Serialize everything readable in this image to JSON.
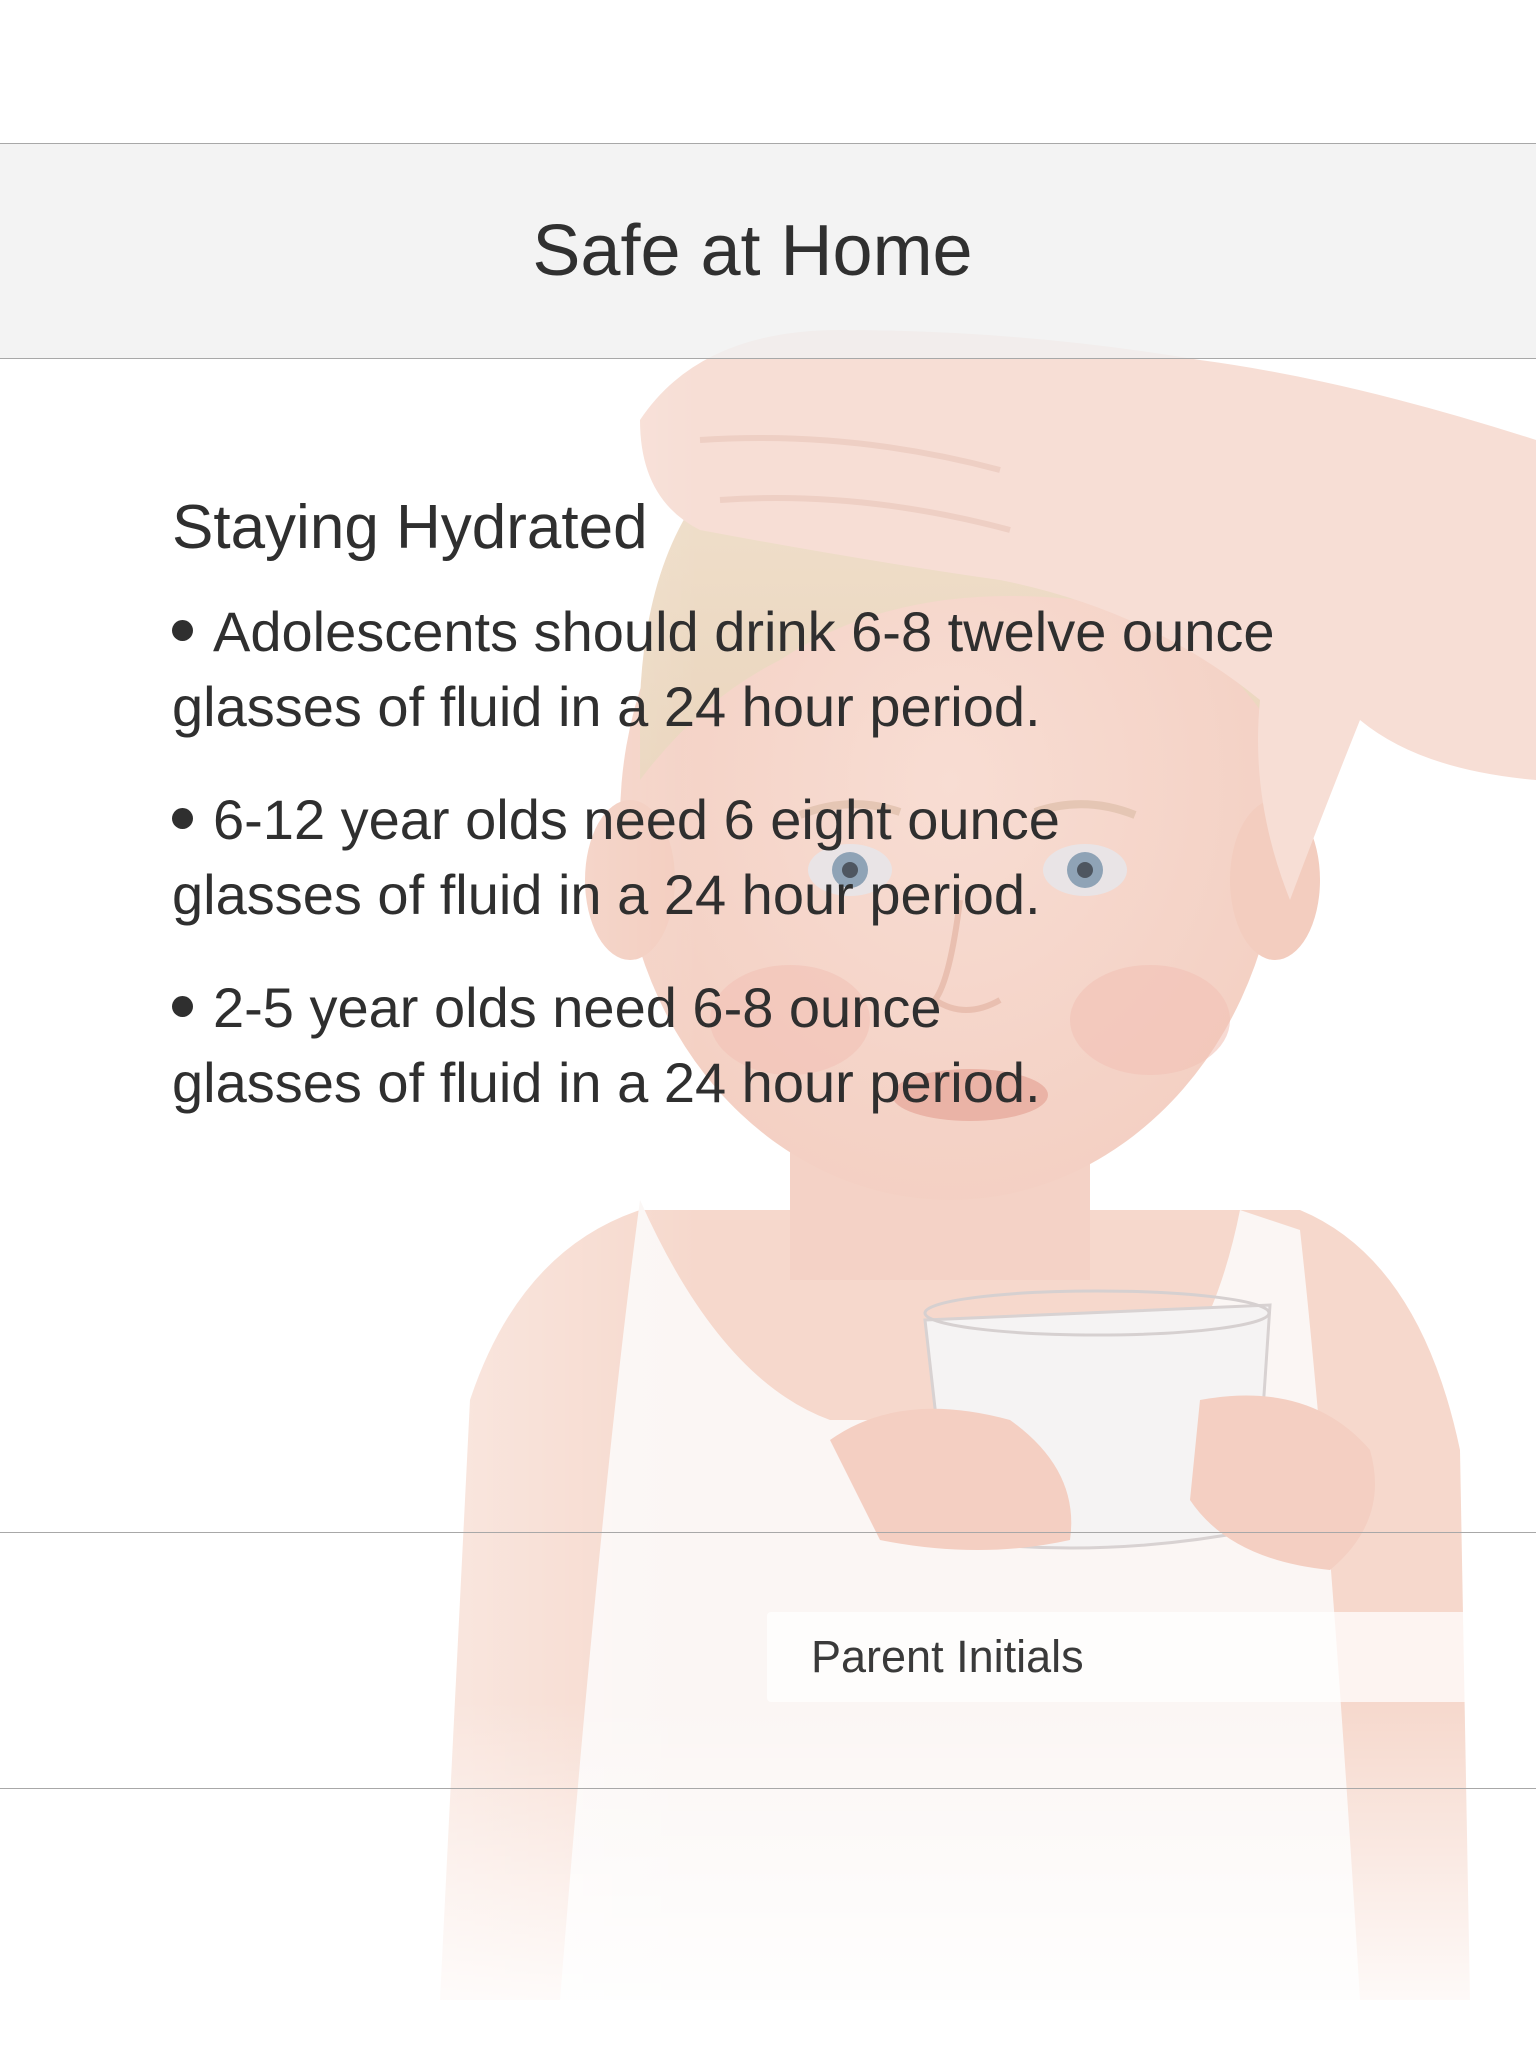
{
  "header": {
    "title": "Safe at Home"
  },
  "section": {
    "heading": "Staying Hydrated",
    "bullets": [
      {
        "line1": "Adolescents should drink 6-8 twelve ounce",
        "line2": "glasses of fluid in a 24 hour period."
      },
      {
        "line1": "6-12 year olds need 6 eight ounce",
        "line2": "glasses of fluid in a 24 hour period."
      },
      {
        "line1": "2-5 year olds need 6-8 ounce",
        "line2": "glasses of fluid in a 24 hour period."
      }
    ]
  },
  "initials_field": {
    "placeholder": "Parent Initials"
  },
  "colors": {
    "text": "#2f2f2f",
    "header_band": "#f0f0f0",
    "rule": "#a8a8a8",
    "skin": "#f5d9cc"
  }
}
